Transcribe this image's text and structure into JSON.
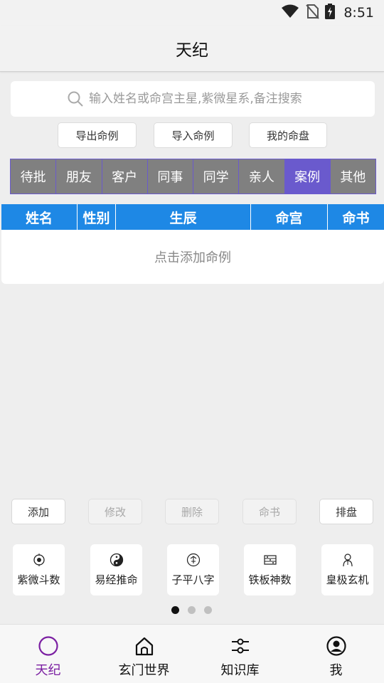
{
  "status": {
    "time": "8:51",
    "icons": [
      "wifi-icon",
      "no-sim-icon",
      "battery-charging-icon"
    ]
  },
  "app": {
    "title": "天纪"
  },
  "search": {
    "placeholder": "输入姓名或命宫主星,紫微星系,备注搜索",
    "value": ""
  },
  "actions": {
    "export_label": "导出命例",
    "import_label": "导入命例",
    "mine_label": "我的命盘"
  },
  "tabs": [
    {
      "label": "待批"
    },
    {
      "label": "朋友"
    },
    {
      "label": "客户"
    },
    {
      "label": "同事"
    },
    {
      "label": "同学"
    },
    {
      "label": "亲人"
    },
    {
      "label": "案例",
      "active": true
    },
    {
      "label": "其他"
    }
  ],
  "table": {
    "columns": [
      "姓名",
      "性别",
      "生辰",
      "命宫",
      "命书"
    ],
    "empty_text": "点击添加命例"
  },
  "operations": [
    {
      "label": "添加",
      "enabled": true
    },
    {
      "label": "修改",
      "enabled": false
    },
    {
      "label": "删除",
      "enabled": false
    },
    {
      "label": "命书",
      "enabled": false
    },
    {
      "label": "排盘",
      "enabled": true
    }
  ],
  "tools": [
    {
      "label": "紫微斗数",
      "icon": "ziwei-icon"
    },
    {
      "label": "易经推命",
      "icon": "yin-yang-icon"
    },
    {
      "label": "子平八字",
      "icon": "ziping-icon"
    },
    {
      "label": "铁板神数",
      "icon": "abacus-icon"
    },
    {
      "label": "皇极玄机",
      "icon": "sage-icon"
    }
  ],
  "pager": {
    "pages": 3,
    "current": 1
  },
  "nav": [
    {
      "label": "天纪",
      "icon": "circle-icon",
      "active": true
    },
    {
      "label": "玄门世界",
      "icon": "home-icon"
    },
    {
      "label": "知识库",
      "icon": "sliders-icon"
    },
    {
      "label": "我",
      "icon": "account-icon"
    }
  ],
  "colors": {
    "accent": "#6a5acd",
    "tab_inactive": "#808080",
    "table_header": "#1e88e5",
    "nav_active": "#7b1fa2"
  }
}
